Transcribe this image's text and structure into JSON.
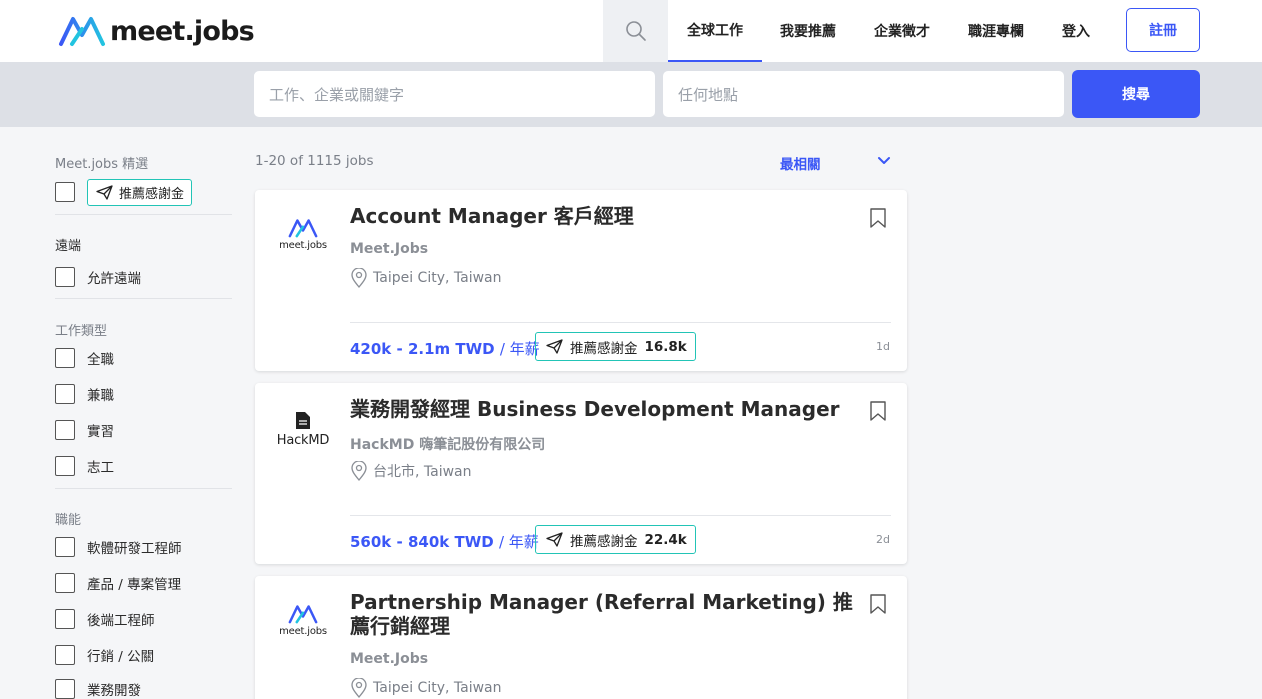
{
  "brand": {
    "name": "meet.jobs",
    "logo_colors": [
      "#3b57f6",
      "#22c4e0"
    ]
  },
  "header": {
    "nav": [
      "全球工作",
      "我要推薦",
      "企業徵才",
      "職涯專欄",
      "登入"
    ],
    "signup": "註冊"
  },
  "search": {
    "keyword_placeholder": "工作、企業或關鍵字",
    "location_placeholder": "任何地點",
    "button": "搜尋"
  },
  "filters": {
    "featured": {
      "title": "Meet.jobs 精選",
      "badge": "推薦感謝金"
    },
    "remote": {
      "title": "遠端",
      "options": [
        "允許遠端"
      ]
    },
    "job_type": {
      "title": "工作類型",
      "options": [
        "全職",
        "兼職",
        "實習",
        "志工"
      ]
    },
    "function": {
      "title": "職能",
      "options": [
        "軟體研發工程師",
        "產品 / 專案管理",
        "後端工程師",
        "行銷 / 公關",
        "業務開發"
      ]
    }
  },
  "results": {
    "count": "1-20 of 1115 jobs",
    "sort": "最相關",
    "jobs": [
      {
        "title": "Account Manager 客戶經理",
        "company": "Meet.Jobs",
        "company_logo": "meet.jobs",
        "location": "Taipei City, Taiwan",
        "salary": "420k - 2.1m TWD",
        "salary_period": "/ 年薪",
        "reward_label": "推薦感謝金",
        "reward_amount": "16.8k",
        "age": "1d"
      },
      {
        "title": "業務開發經理 Business Development Manager",
        "company": "HackMD 嗨筆記股份有限公司",
        "company_logo": "HackMD",
        "location": "台北市, Taiwan",
        "salary": "560k - 840k TWD",
        "salary_period": "/ 年薪",
        "reward_label": "推薦感謝金",
        "reward_amount": "22.4k",
        "age": "2d"
      },
      {
        "title": "Partnership Manager (Referral Marketing) 推薦行銷經理",
        "company": "Meet.Jobs",
        "company_logo": "meet.jobs",
        "location": "Taipei City, Taiwan"
      }
    ]
  }
}
